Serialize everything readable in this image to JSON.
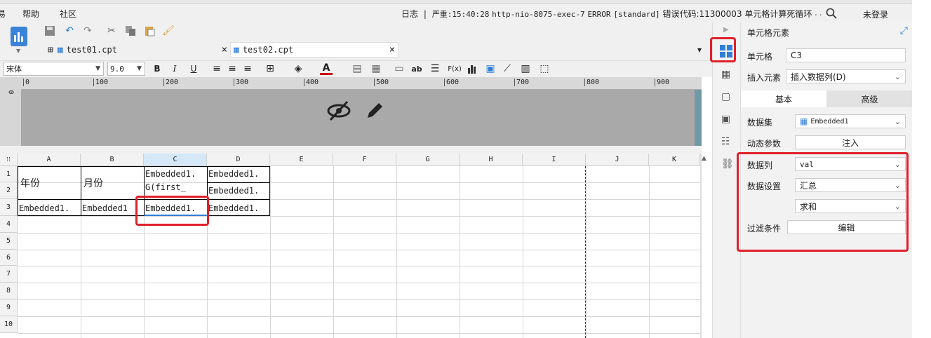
{
  "menu": {
    "items": [
      "帮助",
      "社区"
    ],
    "partial_left": "易"
  },
  "log": {
    "label": "日志",
    "sep": "|",
    "level": "严重:15:40:28",
    "thread": "http-nio-8075-exec-7",
    "kind": "ERROR",
    "tag": "[standard]",
    "message": "错误代码:11300003 单元格计算死循环",
    "dots": "...",
    "login": "未登录"
  },
  "tabs": [
    {
      "label": "test01.cpt",
      "close": "×"
    },
    {
      "label": "test02.cpt",
      "close": "×"
    }
  ],
  "font": {
    "family": "宋体",
    "size": "9.0"
  },
  "format": {
    "bold": "B",
    "italic": "I",
    "underline": "U",
    "fx": "F(x)",
    "ab": "ab"
  },
  "ruler": {
    "ticks": [
      "0",
      "100",
      "200",
      "300",
      "400",
      "500",
      "600",
      "700",
      "800",
      "900"
    ],
    "side": "0"
  },
  "columns": [
    "A",
    "B",
    "C",
    "D",
    "E",
    "F",
    "G",
    "H",
    "I",
    "J",
    "K"
  ],
  "rows": [
    "1",
    "2",
    "3",
    "4",
    "5",
    "6",
    "7",
    "8",
    "9",
    "10"
  ],
  "cells": {
    "a1": "年份",
    "b1": "月份",
    "c1_line1": "Embedded1.",
    "c1_line2": "G(first_",
    "d1": "Embedded1.",
    "d2": "Embedded1.",
    "a3": "Embedded1.",
    "b3": "Embedded1",
    "c3": "Embedded1.",
    "d3": "Embedded1."
  },
  "panel": {
    "title": "单元格元素",
    "cell_label": "单元格",
    "cell_value": "C3",
    "insert_label": "插入元素",
    "insert_value": "插入数据列(D)",
    "tab_basic": "基本",
    "tab_advanced": "高级",
    "dataset_label": "数据集",
    "dataset_value": "Embedded1",
    "dynamic_label": "动态参数",
    "dynamic_button": "注入",
    "column_label": "数据列",
    "column_value": "val",
    "setting_label": "数据设置",
    "setting_value": "汇总",
    "agg_value": "求和",
    "filter_label": "过滤条件",
    "filter_button": "编辑"
  },
  "colors": {
    "accent": "#2f7fd8",
    "highlight": "#e0202a",
    "selected_col": "#d5e8f7"
  }
}
